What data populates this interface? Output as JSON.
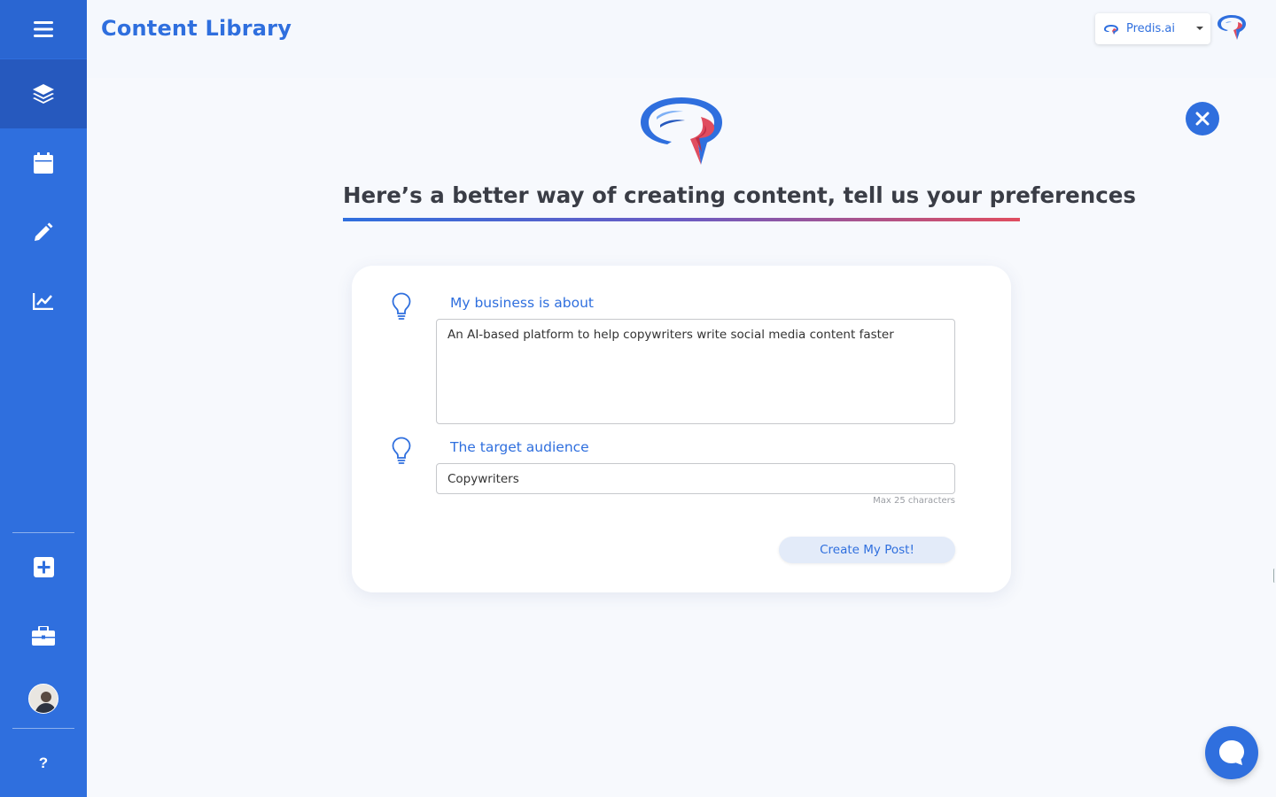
{
  "header": {
    "title": "Content Library",
    "brand_select": {
      "value": "Predis.ai"
    }
  },
  "main": {
    "headline": "Here’s a better way of creating content, tell us your preferences",
    "form": {
      "business": {
        "label": "My business is about",
        "value": "An AI-based platform to help copywriters write social media content faster"
      },
      "audience": {
        "label": "The target audience",
        "value": "Copywriters",
        "hint": "Max 25 characters"
      },
      "submit_label": "Create My Post!"
    }
  },
  "sidebar": {
    "items": [
      {
        "name": "menu-icon"
      },
      {
        "name": "layers-icon",
        "active": true
      },
      {
        "name": "calendar-icon"
      },
      {
        "name": "pencil-icon"
      },
      {
        "name": "chart-icon"
      },
      {
        "name": "add-box-icon"
      },
      {
        "name": "briefcase-icon"
      },
      {
        "name": "avatar"
      },
      {
        "name": "help-icon",
        "label": "?"
      }
    ]
  },
  "colors": {
    "primary": "#2f6fde",
    "sidebar": "#2f6fde",
    "sidebar_active": "#2659be",
    "accent_red": "#e04d5f",
    "button_bg": "#e3ebf9"
  }
}
